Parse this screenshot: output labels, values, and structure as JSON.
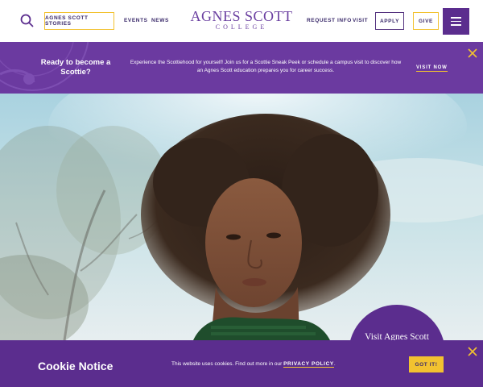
{
  "header": {
    "logo_main": "AGNES SCOTT",
    "logo_sub": "COLLEGE",
    "stories_label": "AGNES SCOTT STORIES",
    "events_label": "EVENTS",
    "news_label": "NEWS",
    "request_info_label": "REQUEST INFO",
    "visit_label": "VISIT",
    "apply_label": "APPLY",
    "give_label": "GIVE",
    "search_icon": "search-icon",
    "menu_icon": "hamburger-menu-icon"
  },
  "banner": {
    "title": "Ready to become a Scottie?",
    "text": "Experience the Scottiehood for yourself! Join us for a Scottie Sneak Peek or schedule a campus visit to discover how an Agnes Scott education prepares you for career success.",
    "cta_label": "VISIT NOW",
    "close_icon": "close-icon"
  },
  "hero": {
    "visit_circle_label": "Visit Agnes Scott"
  },
  "cookie": {
    "title": "Cookie Notice",
    "text_before": "This website uses cookies.  Find out more in our",
    "privacy_label": "PRIVACY POLICY",
    "text_after": ".",
    "button_label": "GOT IT!",
    "close_icon": "close-icon"
  },
  "colors": {
    "brand_purple": "#5b2d8e",
    "banner_purple": "#6b3aa0",
    "accent_gold": "#f2c230",
    "logo_purple": "#6a3fa0"
  }
}
